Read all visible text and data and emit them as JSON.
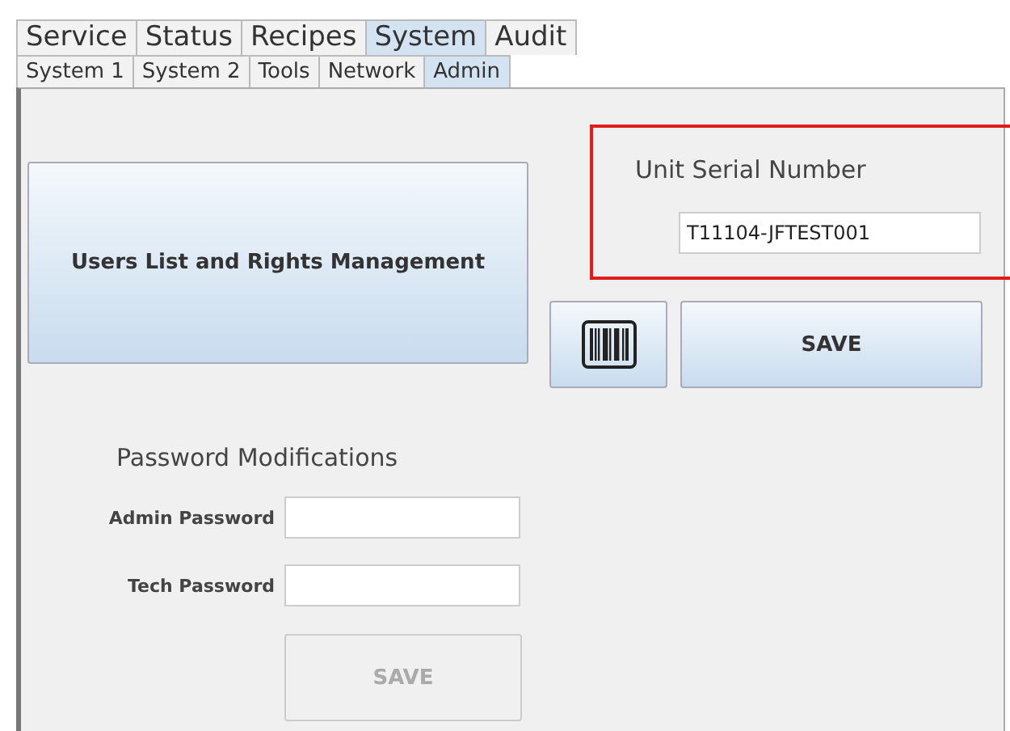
{
  "tabs": [
    {
      "label": "Service",
      "selected": false
    },
    {
      "label": "Status",
      "selected": false
    },
    {
      "label": "Recipes",
      "selected": false
    },
    {
      "label": "System",
      "selected": true
    },
    {
      "label": "Audit",
      "selected": false
    }
  ],
  "subtabs": [
    {
      "label": "System 1",
      "selected": false
    },
    {
      "label": "System 2",
      "selected": false
    },
    {
      "label": "Tools",
      "selected": false
    },
    {
      "label": "Network",
      "selected": false
    },
    {
      "label": "Admin",
      "selected": true
    }
  ],
  "users_button": {
    "label": "Users List and Rights Management"
  },
  "serial": {
    "title": "Unit Serial Number",
    "value": "T11104-JFTEST001",
    "highlighted": true,
    "save": {
      "label": "SAVE",
      "disabled": false
    }
  },
  "passwords": {
    "title": "Password Modifications",
    "fields": [
      {
        "label": "Admin Password"
      },
      {
        "label": "Tech Password"
      }
    ],
    "save": {
      "label": "SAVE",
      "disabled": true
    }
  }
}
